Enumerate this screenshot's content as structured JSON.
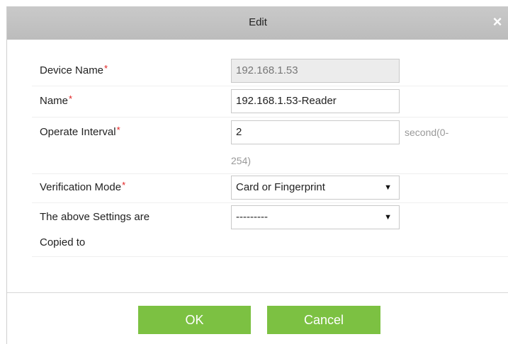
{
  "dialog": {
    "title": "Edit",
    "close_glyph": "×",
    "close_icon": "close-icon"
  },
  "form": {
    "device_name": {
      "label": "Device Name",
      "required_mark": "*",
      "value": "192.168.1.53"
    },
    "name": {
      "label": "Name",
      "required_mark": "*",
      "value": "192.168.1.53-Reader"
    },
    "operate_interval": {
      "label": "Operate Interval",
      "required_mark": "*",
      "value": "2",
      "unit_hint_line1": "second(0-",
      "unit_hint_line2": "254)"
    },
    "verification_mode": {
      "label": "Verification Mode",
      "required_mark": "*",
      "selected": "Card or Fingerprint"
    },
    "copy_to": {
      "label_line1": "The above Settings are",
      "label_line2": "Copied to",
      "selected": "---------"
    },
    "dropdown_arrow_glyph": "▼"
  },
  "buttons": {
    "ok": "OK",
    "cancel": "Cancel"
  },
  "colors": {
    "button": "#7cc142",
    "titlebar": "#c4c4c4",
    "required": "#e02020"
  }
}
